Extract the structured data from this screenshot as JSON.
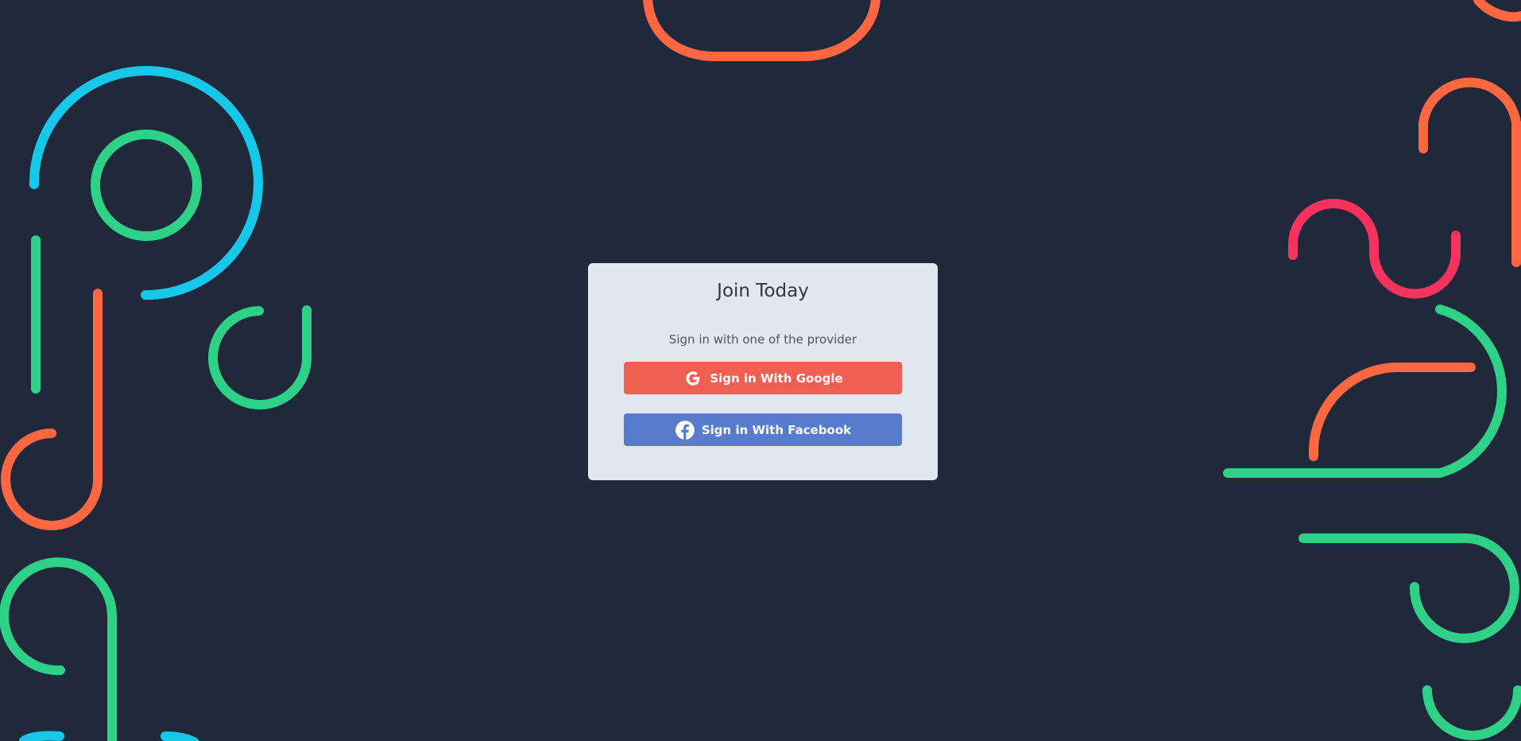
{
  "card": {
    "title": "Join Today",
    "subtitle": "Sign in with one of the provider"
  },
  "providers": {
    "google": {
      "label": "Sign in With Google",
      "icon": "google-icon",
      "color": "#f15f52"
    },
    "facebook": {
      "label": "Sign in With Facebook",
      "icon": "facebook-icon",
      "color": "#577cce"
    }
  },
  "theme": {
    "background": "#1f293a",
    "card_background": "#e2e8f0",
    "decor_colors": {
      "cyan": "#17c7ea",
      "green": "#2fd088",
      "orange": "#ff6743",
      "pink": "#f6325e"
    }
  }
}
